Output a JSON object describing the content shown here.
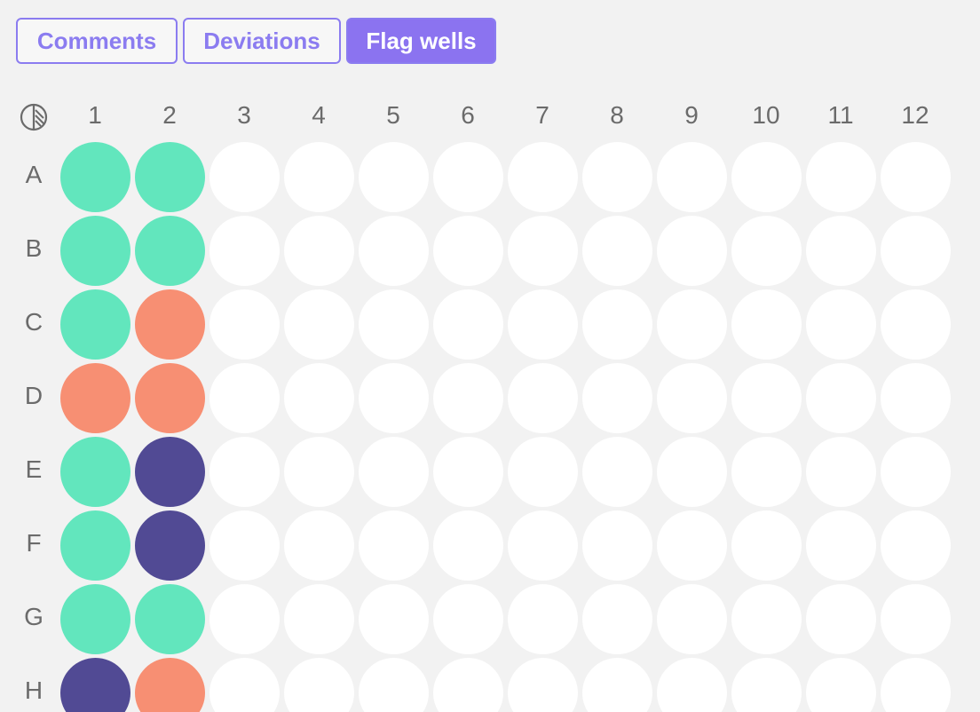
{
  "tabs": [
    {
      "label": "Comments",
      "active": false
    },
    {
      "label": "Deviations",
      "active": false
    },
    {
      "label": "Flag wells",
      "active": true
    }
  ],
  "plate": {
    "icon": "plate-layout-icon",
    "columns": [
      "1",
      "2",
      "3",
      "4",
      "5",
      "6",
      "7",
      "8",
      "9",
      "10",
      "11",
      "12"
    ],
    "rows": [
      "A",
      "B",
      "C",
      "D",
      "E",
      "F",
      "G",
      "H"
    ],
    "status_colors": {
      "green": "#62e6bd",
      "orange": "#f78f73",
      "navy": "#514a94",
      "empty": "#ffffff"
    },
    "wells": [
      [
        "green",
        "green",
        "empty",
        "empty",
        "empty",
        "empty",
        "empty",
        "empty",
        "empty",
        "empty",
        "empty",
        "empty"
      ],
      [
        "green",
        "green",
        "empty",
        "empty",
        "empty",
        "empty",
        "empty",
        "empty",
        "empty",
        "empty",
        "empty",
        "empty"
      ],
      [
        "green",
        "orange",
        "empty",
        "empty",
        "empty",
        "empty",
        "empty",
        "empty",
        "empty",
        "empty",
        "empty",
        "empty"
      ],
      [
        "orange",
        "orange",
        "empty",
        "empty",
        "empty",
        "empty",
        "empty",
        "empty",
        "empty",
        "empty",
        "empty",
        "empty"
      ],
      [
        "green",
        "navy",
        "empty",
        "empty",
        "empty",
        "empty",
        "empty",
        "empty",
        "empty",
        "empty",
        "empty",
        "empty"
      ],
      [
        "green",
        "navy",
        "empty",
        "empty",
        "empty",
        "empty",
        "empty",
        "empty",
        "empty",
        "empty",
        "empty",
        "empty"
      ],
      [
        "green",
        "green",
        "empty",
        "empty",
        "empty",
        "empty",
        "empty",
        "empty",
        "empty",
        "empty",
        "empty",
        "empty"
      ],
      [
        "navy",
        "orange",
        "empty",
        "empty",
        "empty",
        "empty",
        "empty",
        "empty",
        "empty",
        "empty",
        "empty",
        "empty"
      ]
    ]
  }
}
